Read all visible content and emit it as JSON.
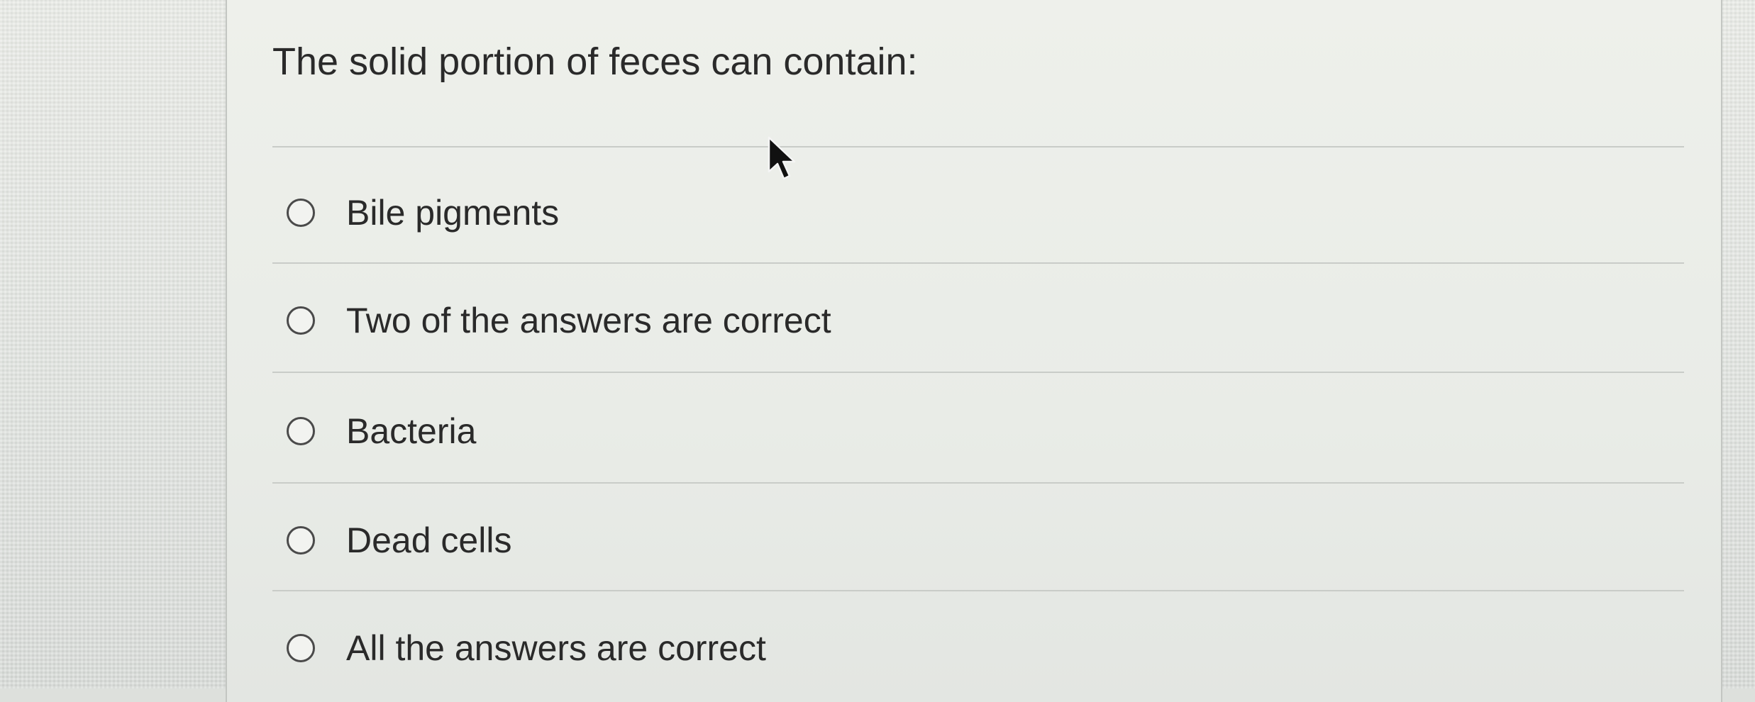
{
  "question": {
    "title": "The solid portion of feces can contain:"
  },
  "options": [
    {
      "label": "Bile pigments",
      "selected": false
    },
    {
      "label": "Two of the answers are correct",
      "selected": false
    },
    {
      "label": "Bacteria",
      "selected": false
    },
    {
      "label": "Dead cells",
      "selected": false
    },
    {
      "label": "All the answers are correct",
      "selected": false
    }
  ],
  "icons": {
    "cursor": "arrow-cursor-icon",
    "radio": "radio-unchecked-icon"
  },
  "colors": {
    "text": "#2a2a2a",
    "background": "#e9ece7",
    "divider": "#c9ccc8"
  }
}
